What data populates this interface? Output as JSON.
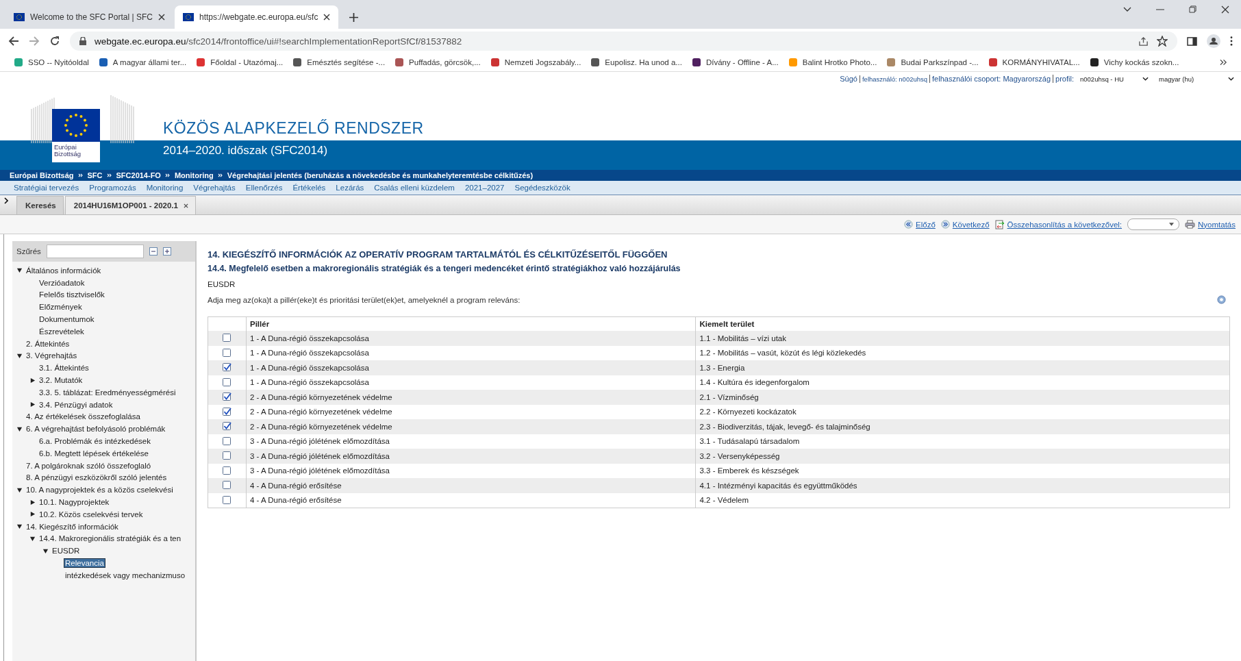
{
  "browser": {
    "tabs": [
      {
        "title": "Welcome to the SFC Portal | SFC",
        "selected": false
      },
      {
        "title": "https://webgate.ec.europa.eu/sfc",
        "selected": true
      }
    ],
    "url": {
      "host": "webgate.ec.europa.eu",
      "path": "/sfc2014/frontoffice/ui#!searchImplementationReportSfCf/81537882"
    },
    "bookmarks": [
      "SSO -- Nyitóoldal",
      "A magyar állami ter...",
      "Főoldal - Utazómaj...",
      "Emésztés segítése -...",
      "Puffadás, görcsök,...",
      "Nemzeti Jogszabály...",
      "Eupolisz. Ha unod a...",
      "Dívány - Offline - A...",
      "Balint Hrotko Photo...",
      "Budai Parkszínpad -...",
      "KORMÁNYHIVATAL...",
      "Vichy kockás szokn..."
    ]
  },
  "user_bar": {
    "help": "Súgó",
    "user": "felhasználó: n002uhsq",
    "group": "felhasználói csoport: Magyarország",
    "profile_label": "profil:",
    "profile": "n002uhsq - HU",
    "language": "magyar (hu)"
  },
  "header": {
    "logo_text": "Európai Bizottság",
    "title": "KÖZÖS ALAPKEZELŐ RENDSZER",
    "subtitle": "2014–2020. időszak (SFC2014)"
  },
  "breadcrumbs": [
    "Európai Bizottság",
    "SFC",
    "SFC2014-FO",
    "Monitoring",
    "Végrehajtási jelentés (beruházás a növekedésbe és munkahelyteremtésbe célkitűzés)"
  ],
  "menu": [
    "Stratégiai tervezés",
    "Programozás",
    "Monitoring",
    "Végrehajtás",
    "Ellenőrzés",
    "Értékelés",
    "Lezárás",
    "Csalás elleni küzdelem",
    "2021–2027",
    "Segédeszközök"
  ],
  "page_tabs": [
    {
      "label": "Keresés",
      "selected": false,
      "closable": false
    },
    {
      "label": "2014HU16M1OP001 - 2020.1",
      "selected": true,
      "closable": true
    }
  ],
  "toolbar": {
    "previous": "Előző",
    "next": "Következő",
    "compare": "Összehasonlítás a következővel:",
    "print": "Nyomtatás"
  },
  "sidebar": {
    "filter_label": "Szűrés",
    "tree": [
      {
        "label": "Általános információk",
        "kind": "folder",
        "expanded": true,
        "selected": false,
        "children": [
          {
            "label": "Verzióadatok",
            "kind": "leaf",
            "selected": false
          },
          {
            "label": "Felelős tisztviselők",
            "kind": "leaf",
            "selected": false
          },
          {
            "label": "Előzmények",
            "kind": "leaf",
            "selected": false
          },
          {
            "label": "Dokumentumok",
            "kind": "leaf",
            "selected": false
          },
          {
            "label": "Észrevételek",
            "kind": "leaf",
            "selected": false
          }
        ]
      },
      {
        "label": "2. Áttekintés",
        "kind": "leaf",
        "selected": false
      },
      {
        "label": "3. Végrehajtás",
        "kind": "folder",
        "expanded": true,
        "selected": false,
        "children": [
          {
            "label": "3.1. Áttekintés",
            "kind": "leaf",
            "selected": false
          },
          {
            "label": "3.2. Mutatók",
            "kind": "folder",
            "expanded": false,
            "selected": false
          },
          {
            "label": "3.3. 5. táblázat: Eredményességmérési",
            "kind": "leaf",
            "selected": false
          },
          {
            "label": "3.4. Pénzügyi adatok",
            "kind": "folder",
            "expanded": false,
            "selected": false
          }
        ]
      },
      {
        "label": "4. Az értékelések összefoglalása",
        "kind": "leaf",
        "selected": false
      },
      {
        "label": "6. A végrehajtást befolyásoló problémák",
        "kind": "folder",
        "expanded": true,
        "selected": false,
        "children": [
          {
            "label": "6.a. Problémák és intézkedések",
            "kind": "leaf",
            "selected": false
          },
          {
            "label": "6.b. Megtett lépések értékelése",
            "kind": "leaf",
            "selected": false
          }
        ]
      },
      {
        "label": "7. A polgároknak szóló összefoglaló",
        "kind": "leaf",
        "selected": false
      },
      {
        "label": "8. A pénzügyi eszközökről szóló jelentés",
        "kind": "leaf",
        "selected": false
      },
      {
        "label": "10. A nagyprojektek és a közös cselekvési",
        "kind": "folder",
        "expanded": true,
        "selected": false,
        "children": [
          {
            "label": "10.1. Nagyprojektek",
            "kind": "folder",
            "expanded": false,
            "selected": false
          },
          {
            "label": "10.2. Közös cselekvési tervek",
            "kind": "folder",
            "expanded": false,
            "selected": false
          }
        ]
      },
      {
        "label": "14. Kiegészítő információk",
        "kind": "folder",
        "expanded": true,
        "selected": false,
        "children": [
          {
            "label": "14.4. Makroregionális stratégiák és a ten",
            "kind": "folder",
            "expanded": true,
            "selected": false,
            "children": [
              {
                "label": "EUSDR",
                "kind": "folder",
                "expanded": true,
                "selected": false,
                "children": [
                  {
                    "label": "Relevancia",
                    "kind": "leaf",
                    "selected": true
                  },
                  {
                    "label": "intézkedések vagy mechanizmuso",
                    "kind": "leaf",
                    "selected": false
                  }
                ]
              }
            ]
          }
        ]
      }
    ]
  },
  "content": {
    "heading": "14. KIEGÉSZÍTŐ INFORMÁCIÓK AZ OPERATÍV PROGRAM TARTALMÁTÓL ÉS CÉLKITŰZÉSEITŐL FÜGGŐEN",
    "subheading": "14.4. Megfelelő esetben a makroregionális stratégiák és a tengeri medencéket érintő stratégiákhoz való hozzájárulás",
    "strategy": "EUSDR",
    "instruction": "Adja meg az(oka)t a pillér(eke)t és prioritási terület(ek)et, amelyeknél a program releváns:",
    "table": {
      "columns": [
        "Pillér",
        "Kiemelt terület"
      ],
      "rows": [
        {
          "checked": false,
          "pillar": "1 - A Duna-régió összekapcsolása",
          "area": "1.1 - Mobilitás – vízi utak"
        },
        {
          "checked": false,
          "pillar": "1 - A Duna-régió összekapcsolása",
          "area": "1.2 - Mobilitás – vasút, közút és légi közlekedés"
        },
        {
          "checked": true,
          "pillar": "1 - A Duna-régió összekapcsolása",
          "area": "1.3 - Energia"
        },
        {
          "checked": false,
          "pillar": "1 - A Duna-régió összekapcsolása",
          "area": "1.4 - Kultúra és idegenforgalom"
        },
        {
          "checked": true,
          "pillar": "2 - A Duna-régió környezetének védelme",
          "area": "2.1 - Vízminőség"
        },
        {
          "checked": true,
          "pillar": "2 - A Duna-régió környezetének védelme",
          "area": "2.2 - Környezeti kockázatok"
        },
        {
          "checked": true,
          "pillar": "2 - A Duna-régió környezetének védelme",
          "area": "2.3 - Biodiverzitás, tájak, levegő- és talajminőség"
        },
        {
          "checked": false,
          "pillar": "3 - A Duna-régió jólétének előmozdítása",
          "area": "3.1 - Tudásalapú társadalom"
        },
        {
          "checked": false,
          "pillar": "3 - A Duna-régió jólétének előmozdítása",
          "area": "3.2 - Versenyképesség"
        },
        {
          "checked": false,
          "pillar": "3 - A Duna-régió jólétének előmozdítása",
          "area": "3.3 - Emberek és készségek"
        },
        {
          "checked": false,
          "pillar": "4 - A Duna-régió erősítése",
          "area": "4.1 - Intézményi kapacitás és együttműködés"
        },
        {
          "checked": false,
          "pillar": "4 - A Duna-régió erősítése",
          "area": "4.2 - Védelem"
        }
      ]
    }
  }
}
